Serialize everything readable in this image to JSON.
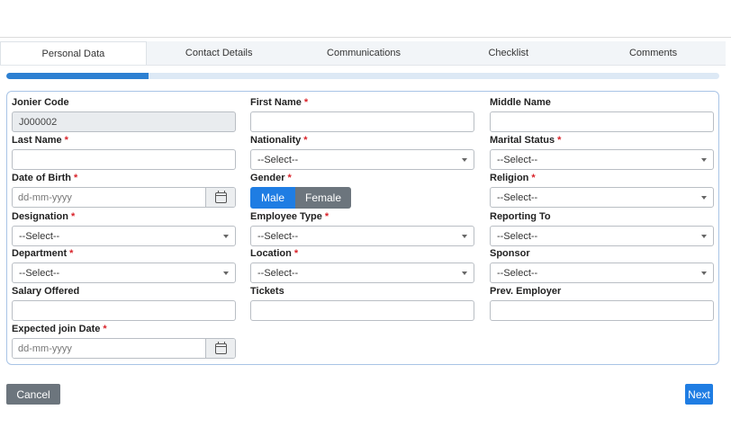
{
  "tabs": [
    {
      "label": "Personal Data",
      "active": true
    },
    {
      "label": "Contact Details",
      "active": false
    },
    {
      "label": "Communications",
      "active": false
    },
    {
      "label": "Checklist",
      "active": false
    },
    {
      "label": "Comments",
      "active": false
    }
  ],
  "progress": {
    "fraction": 0.2
  },
  "form": {
    "jonier_code": {
      "label": "Jonier Code",
      "value": "J000002"
    },
    "first_name": {
      "label": "First Name",
      "required_mark": "*",
      "value": ""
    },
    "middle_name": {
      "label": "Middle Name",
      "value": ""
    },
    "last_name": {
      "label": "Last Name",
      "required_mark": "*",
      "value": ""
    },
    "nationality": {
      "label": "Nationality",
      "required_mark": "*",
      "selected": "--Select--"
    },
    "marital_status": {
      "label": "Marital Status",
      "required_mark": "*",
      "selected": "--Select--"
    },
    "date_of_birth": {
      "label": "Date of Birth",
      "required_mark": "*",
      "placeholder": "dd-mm-yyyy"
    },
    "gender": {
      "label": "Gender",
      "required_mark": "*",
      "options": [
        "Male",
        "Female"
      ],
      "selected": "Male"
    },
    "religion": {
      "label": "Religion",
      "required_mark": "*",
      "selected": "--Select--"
    },
    "designation": {
      "label": "Designation",
      "required_mark": "*",
      "selected": "--Select--"
    },
    "employee_type": {
      "label": "Employee Type",
      "required_mark": "*",
      "selected": "--Select--"
    },
    "reporting_to": {
      "label": "Reporting To",
      "selected": "--Select--"
    },
    "department": {
      "label": "Department",
      "required_mark": "*",
      "selected": "--Select--"
    },
    "location": {
      "label": "Location",
      "required_mark": "*",
      "selected": "--Select--"
    },
    "sponsor": {
      "label": "Sponsor",
      "selected": "--Select--"
    },
    "salary_offered": {
      "label": "Salary Offered",
      "value": ""
    },
    "tickets": {
      "label": "Tickets",
      "value": ""
    },
    "prev_employer": {
      "label": "Prev. Employer",
      "value": ""
    },
    "expected_join_date": {
      "label": "Expected join Date",
      "required_mark": "*",
      "placeholder": "dd-mm-yyyy"
    }
  },
  "actions": {
    "cancel_label": "Cancel",
    "next_label": "Next"
  },
  "colors": {
    "primary": "#1f7de3",
    "secondary": "#6c757d",
    "required": "#d9232a",
    "form_border": "#a9c4e6"
  },
  "icons": {
    "date_picker": "calendar-icon",
    "select": "caret-down-icon"
  }
}
